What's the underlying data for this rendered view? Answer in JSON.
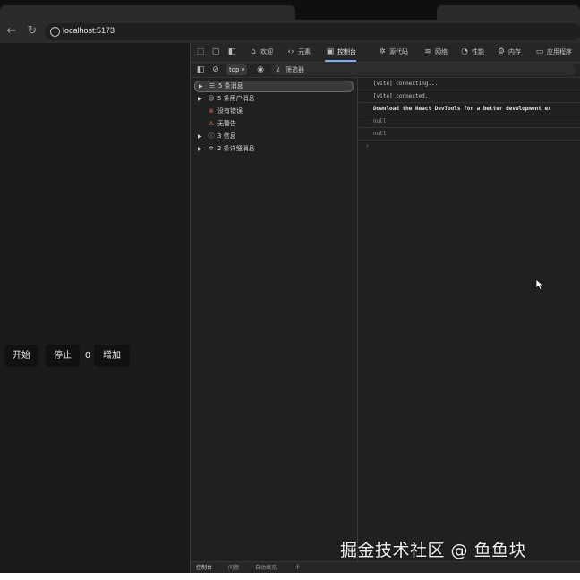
{
  "browser": {
    "url": "localhost:5173",
    "nav": {
      "back_icon": "arrow-left-icon",
      "reload_icon": "reload-icon"
    }
  },
  "app": {
    "start_label": "开始",
    "stop_label": "停止",
    "count": "0",
    "add_label": "增加"
  },
  "devtools": {
    "tabs": [
      {
        "label": "欢迎",
        "icon": "home-icon"
      },
      {
        "label": "元素",
        "icon": "code-icon"
      },
      {
        "label": "控制台",
        "icon": "console-icon",
        "active": true
      },
      {
        "label": "源代码",
        "icon": "bug-icon"
      },
      {
        "label": "网络",
        "icon": "wifi-icon"
      },
      {
        "label": "性能",
        "icon": "gauge-icon"
      },
      {
        "label": "内存",
        "icon": "gear-icon"
      },
      {
        "label": "应用程序",
        "icon": "app-icon"
      }
    ],
    "toolbar": {
      "context": "top ▾",
      "filter_label": "筛选器"
    },
    "sidebar": [
      {
        "label": "5 条消息",
        "icon": "list-icon",
        "expandable": true,
        "selected": true
      },
      {
        "label": "5 条用户消息",
        "icon": "user-icon",
        "expandable": true
      },
      {
        "label": "没有错误",
        "icon": "error-icon",
        "expandable": false
      },
      {
        "label": "无警告",
        "icon": "warning-icon",
        "expandable": false
      },
      {
        "label": "3 信息",
        "icon": "info-icon",
        "expandable": true
      },
      {
        "label": "2 条详细消息",
        "icon": "verbose-icon",
        "expandable": true
      }
    ],
    "console": [
      {
        "text": "[vite] connecting...",
        "style": "normal"
      },
      {
        "text": "[vite] connected.",
        "style": "normal"
      },
      {
        "text": "Download the React DevTools for a better development ex",
        "style": "bold"
      },
      {
        "text": "null",
        "style": "muted"
      },
      {
        "text": "null",
        "style": "muted"
      }
    ],
    "prompt": "›",
    "drawer_tabs": [
      "控制台",
      "问题",
      "自动填充",
      "+"
    ]
  },
  "watermark": "掘金技术社区 @ 鱼鱼块",
  "colors": {
    "accent": "#7cacf8",
    "background": "#1b1b1b",
    "button": "#111111"
  }
}
